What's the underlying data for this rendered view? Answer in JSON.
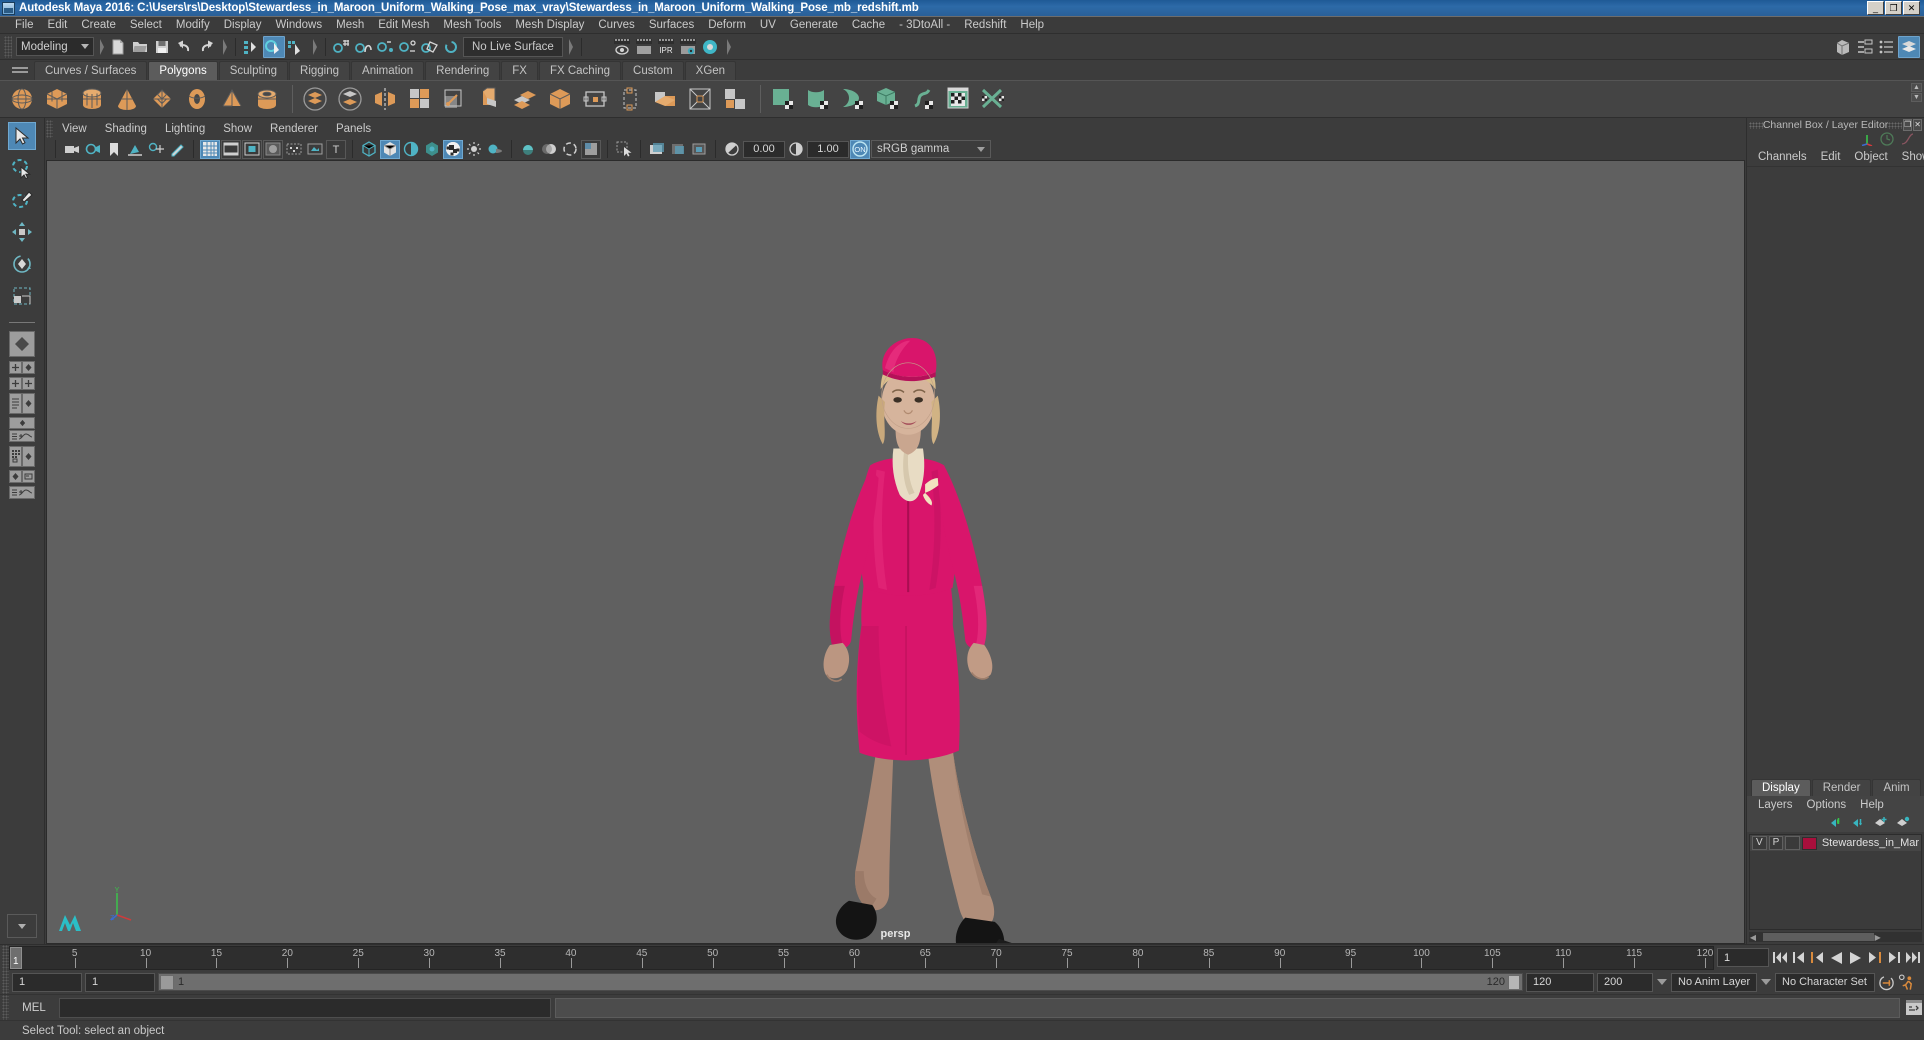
{
  "window": {
    "title": "Autodesk Maya 2016: C:\\Users\\rs\\Desktop\\Stewardess_in_Maroon_Uniform_Walking_Pose_max_vray\\Stewardess_in_Maroon_Uniform_Walking_Pose_mb_redshift.mb",
    "app_icon": "maya-icon",
    "minimize": "_",
    "maximize": "❐",
    "close": "✕"
  },
  "menubar": {
    "items": [
      "File",
      "Edit",
      "Create",
      "Select",
      "Modify",
      "Display",
      "Windows",
      "Mesh",
      "Edit Mesh",
      "Mesh Tools",
      "Mesh Display",
      "Curves",
      "Surfaces",
      "Deform",
      "UV",
      "Generate",
      "Cache",
      "- 3DtoAll -",
      "Redshift",
      "Help"
    ]
  },
  "statusline": {
    "menu_set": "Modeling",
    "live_surface": "No Live Surface",
    "icons": {
      "new_scene": "new-scene-icon",
      "open_scene": "open-scene-icon",
      "save_scene": "save-scene-icon",
      "undo": "undo-icon",
      "redo": "redo-icon",
      "select_hierarchy": "select-by-hierarchy-icon",
      "select_object": "select-by-object-icon",
      "select_component": "select-by-component-icon",
      "snap_grid": "snap-to-grid-icon",
      "snap_curve": "snap-to-curve-icon",
      "snap_point": "snap-to-point-icon",
      "snap_projected": "snap-to-projected-center-icon",
      "snap_view_plane": "snap-to-view-plane-icon",
      "make_live": "make-live-icon",
      "render_current": "render-current-frame-icon",
      "ipr_render": "ipr-render-icon",
      "render_settings": "render-settings-icon",
      "render_view": "render-view-icon",
      "hypershade": "hypershade-icon",
      "sidebar_channelbox": "show-channel-box-icon",
      "sidebar_attr": "show-attribute-editor-icon",
      "sidebar_tool": "show-tool-settings-icon",
      "sidebar_layers": "show-layer-editor-icon"
    }
  },
  "shelf": {
    "tabs": [
      "Curves / Surfaces",
      "Polygons",
      "Sculpting",
      "Rigging",
      "Animation",
      "Rendering",
      "FX",
      "FX Caching",
      "Custom",
      "XGen"
    ],
    "active_tab": "Polygons",
    "icons_group1": [
      "poly-sphere-icon",
      "poly-cube-icon",
      "poly-cylinder-icon",
      "poly-cone-icon",
      "poly-plane-icon",
      "poly-torus-icon",
      "poly-pyramid-icon",
      "poly-pipe-icon"
    ],
    "icons_group2": [
      "combine-icon",
      "separate-icon",
      "mirror-geometry-icon",
      "smooth-icon",
      "extrude-icon",
      "booleans-icon",
      "multi-cut-icon",
      "insert-edge-loop-icon",
      "offset-edge-loop-icon",
      "bevel-icon",
      "bridge-icon",
      "append-polygon-icon",
      "fill-hole-icon",
      "quad-draw-icon",
      "target-weld-icon",
      "merge-icon"
    ],
    "icons_group3": [
      "uv-planar-icon",
      "uv-cylindrical-icon",
      "uv-spherical-icon",
      "uv-automatic-icon",
      "uv-unfold-icon",
      "uv-editor-icon",
      "uv-cut-sew-icon"
    ]
  },
  "viewport": {
    "menus": [
      "View",
      "Shading",
      "Lighting",
      "Show",
      "Renderer",
      "Panels"
    ],
    "camera_label": "persp",
    "exposure": "0.00",
    "gamma_value": "1.00",
    "color_management": "sRGB gamma",
    "color_mgmt_toggle": "ON",
    "toolbar_icons": [
      "select-camera-icon",
      "camera-attributes-icon",
      "bookmark-icon",
      "image-plane-icon",
      "twoD-pan-zoom-icon",
      "grease-pencil-icon",
      "grid-toggle-icon",
      "film-gate-icon",
      "resolution-gate-icon",
      "gate-mask-icon",
      "film-origin-icon",
      "exposure-icon",
      "xray-icon",
      "wireframe-shaded-icon",
      "smooth-shade-all-icon",
      "shade-wireframe-icon",
      "use-default-material-icon",
      "textured-icon",
      "use-all-lights-icon",
      "shadows-icon",
      "screen-space-ao-icon",
      "motion-blur-icon",
      "multisample-icon",
      "depth-of-field-icon",
      "isolate-select-icon",
      "xray-joints-icon",
      "xray-active-components-icon",
      "exposure-control-icon"
    ]
  },
  "right_panel": {
    "title": "Channel Box / Layer Editor",
    "title_buttons": [
      "undock-icon",
      "close-icon"
    ],
    "header_icons": [
      "axis-indicator-icon",
      "clock-icon",
      "curve-icon"
    ],
    "channel_menus": [
      "Channels",
      "Edit",
      "Object",
      "Show"
    ],
    "layer_tabs": [
      "Display",
      "Render",
      "Anim"
    ],
    "layer_active_tab": "Display",
    "layer_menus": [
      "Layers",
      "Options",
      "Help"
    ],
    "layer_toolbar_icons": [
      "move-layer-up-icon",
      "move-layer-down-icon",
      "new-layer-icon",
      "new-layer-from-selected-icon"
    ],
    "layers": [
      {
        "visibility": "V",
        "playback": "P",
        "type": "",
        "color": "#a80f3c",
        "name": "Stewardess_in_Maroon"
      }
    ]
  },
  "timeline": {
    "start": 1,
    "end": 120,
    "current_frame": "1",
    "ticks": [
      5,
      10,
      15,
      20,
      25,
      30,
      35,
      40,
      45,
      50,
      55,
      60,
      65,
      70,
      75,
      80,
      85,
      90,
      95,
      100,
      105,
      110,
      115,
      120
    ],
    "playback_buttons": [
      "go-to-start-icon",
      "step-back-frame-icon",
      "step-back-key-icon",
      "play-backwards-icon",
      "play-forwards-icon",
      "step-forward-key-icon",
      "step-forward-frame-icon",
      "go-to-end-icon"
    ]
  },
  "range": {
    "anim_start": "1",
    "range_start": "1",
    "slider_start_value": "1",
    "slider_end_value": "120",
    "range_end": "120",
    "anim_end": "200",
    "anim_layer": "No Anim Layer",
    "character_set": "No Character Set",
    "auto_key_icon": "auto-keyframe-icon",
    "anim_prefs_icon": "animation-preferences-icon"
  },
  "command_line": {
    "language": "MEL",
    "input_value": "",
    "script_editor_icon": "script-editor-icon"
  },
  "help_line": {
    "text": "Select Tool: select an object"
  },
  "toolbox": {
    "tools": [
      "select-tool",
      "lasso-select-tool",
      "paint-select-tool",
      "move-tool",
      "rotate-tool",
      "scale-tool"
    ],
    "active_tool": "select-tool",
    "layouts": [
      "single-perspective-layout",
      "four-view-layout",
      "outliner-persp-layout",
      "hypergraph-persp-layout",
      "persp-graph-layout",
      "hypershade-persp-layout",
      "outliner-graph-layout",
      "saved-layouts-menu"
    ]
  },
  "colors": {
    "accent_blue": "#4e88b5",
    "shelf_orange": "#dd9a58",
    "shelf_green": "#69b093",
    "layer_color": "#a80f3c",
    "title_blue": "#2d6aa8",
    "viewport_bg": "#606060",
    "dress": "#d9156b"
  }
}
